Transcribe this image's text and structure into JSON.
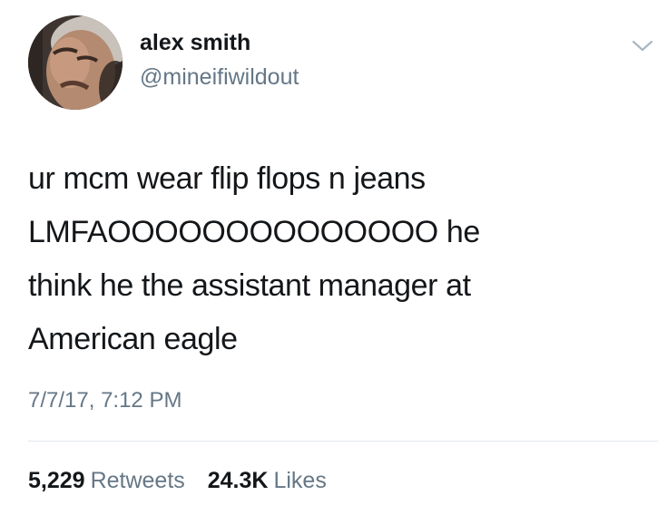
{
  "user": {
    "display_name": "alex smith",
    "handle": "@mineifiwildout",
    "avatar": "profile-photo"
  },
  "menu": {
    "icon": "chevron-down-icon"
  },
  "tweet": {
    "lines": [
      "ur mcm wear flip flops n jeans",
      "LMFAOOOOOOOOOOOOOO he",
      "think he the assistant manager at",
      "American eagle"
    ],
    "timestamp": "7/7/17, 7:12 PM"
  },
  "stats": {
    "retweets_count": "5,229",
    "retweets_label": "Retweets",
    "likes_count": "24.3K",
    "likes_label": "Likes"
  },
  "colors": {
    "text": "#14171a",
    "secondary": "#657786",
    "divider": "#e1e8ed"
  }
}
